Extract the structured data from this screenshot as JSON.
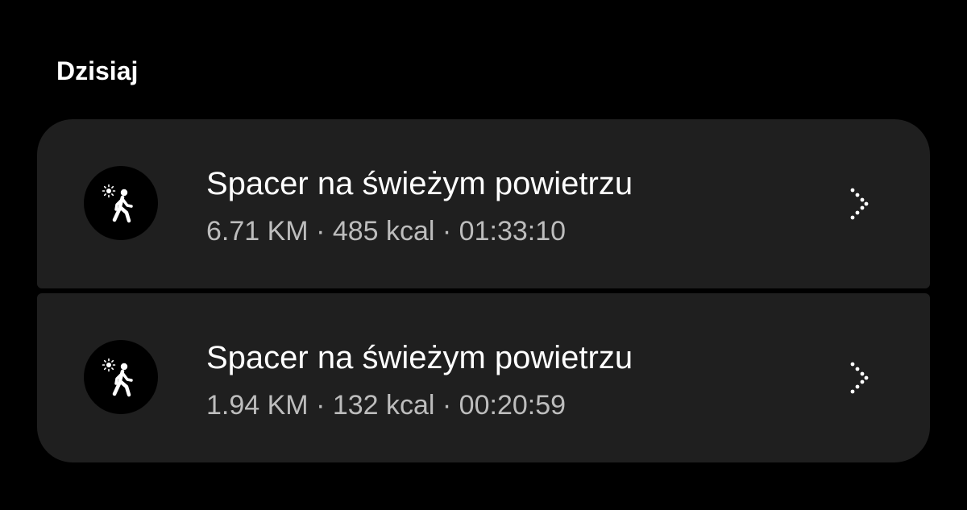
{
  "section": {
    "title": "Dzisiaj"
  },
  "activities": [
    {
      "name": "Spacer na świeżym powietrzu",
      "stats": "6.71 KM · 485 kcal · 01:33:10",
      "icon": "outdoor-walk-icon"
    },
    {
      "name": "Spacer na świeżym powietrzu",
      "stats": "1.94 KM · 132 kcal · 00:20:59",
      "icon": "outdoor-walk-icon"
    }
  ],
  "colors": {
    "background": "#000000",
    "card": "#1f1f1f",
    "primary_text": "#ffffff",
    "secondary_text": "#bdbdbd"
  }
}
